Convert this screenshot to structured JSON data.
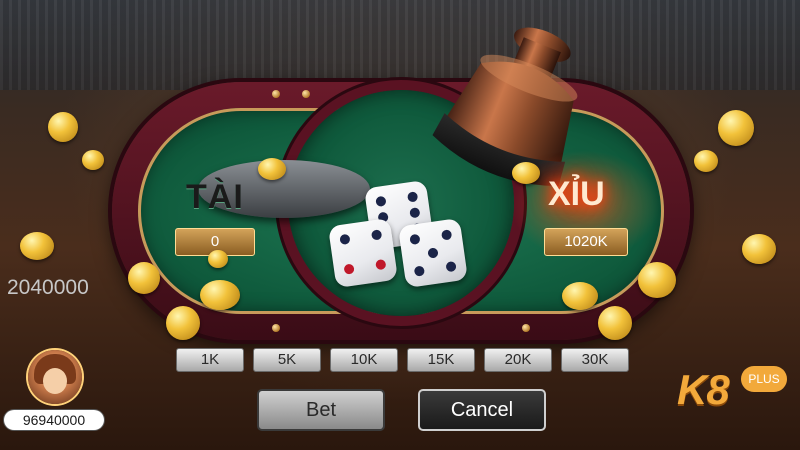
{
  "table": {
    "tai_label": "TÀI",
    "xiu_label": "XỈU",
    "tai_amount": "0",
    "xiu_amount": "1020K"
  },
  "player": {
    "total_bet": "2040000",
    "balance": "96940000"
  },
  "chips": [
    "1K",
    "5K",
    "10K",
    "15K",
    "20K",
    "30K"
  ],
  "actions": {
    "bet_label": "Bet",
    "cancel_label": "Cancel"
  },
  "logo": {
    "brand": "K8",
    "badge": "PLUS"
  },
  "colors": {
    "felt": "#0f5a3c",
    "rail": "#5a1222",
    "gold": "#f2c23a",
    "brand": "#f2a93b"
  },
  "icons": {
    "dice_cup": "dice-cup-icon",
    "coin": "gold-coin-icon"
  }
}
